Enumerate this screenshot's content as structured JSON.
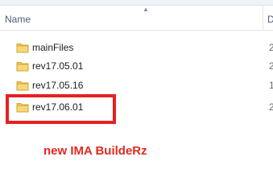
{
  "header": {
    "name_label": "Name",
    "next_column_label": "D"
  },
  "files": [
    {
      "label": "mainFiles",
      "date_fragment": "2"
    },
    {
      "label": "rev17.05.01",
      "date_fragment": "2"
    },
    {
      "label": "rev17.05.16",
      "date_fragment": "1"
    },
    {
      "label": "rev17.06.01",
      "date_fragment": "2"
    }
  ],
  "annotation": {
    "text": "new IMA BuildeRz"
  },
  "colors": {
    "highlight_red": "#e52122",
    "annotation_red": "#e02a21",
    "folder_yellow": "#f3c755"
  },
  "icons": {
    "folder": "folder-icon",
    "sort": "sort-arrow-icon"
  }
}
